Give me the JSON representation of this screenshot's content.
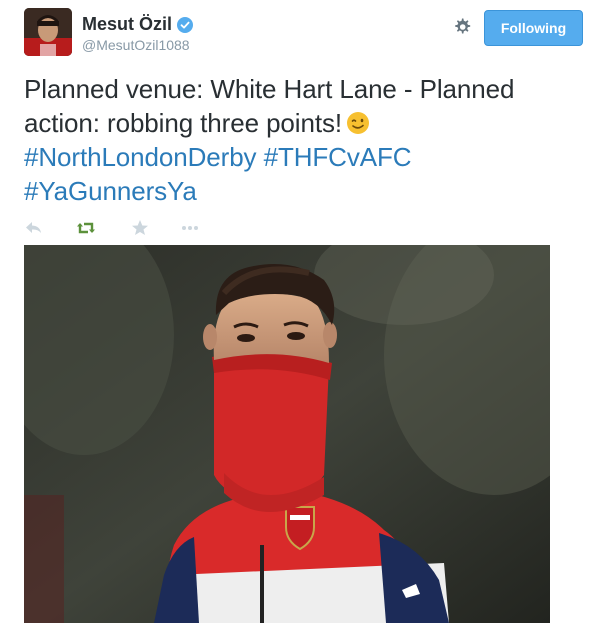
{
  "user": {
    "name": "Mesut Özil",
    "handle": "@MesutOzil1088",
    "verified": true
  },
  "follow_button": {
    "label": "Following"
  },
  "tweet": {
    "text_line1": "Planned venue: White Hart Lane - Planned",
    "text_line2": "action: robbing three points!",
    "emoji": "winking-face",
    "hashtags": [
      "#NorthLondonDerby",
      "#THFCvAFC",
      "#YaGunnersYa"
    ]
  },
  "actions": [
    "reply",
    "retweet",
    "favorite",
    "more"
  ],
  "photo": {
    "badge_text": "Arsenal",
    "description_icons": [
      "arsenal-crest-icon",
      "puma-logo-icon"
    ]
  },
  "colors": {
    "accent": "#55acee",
    "hashtag": "#2b7bb9",
    "retweet": "#5c913b",
    "muted": "#8899a6",
    "text": "#292f33"
  }
}
